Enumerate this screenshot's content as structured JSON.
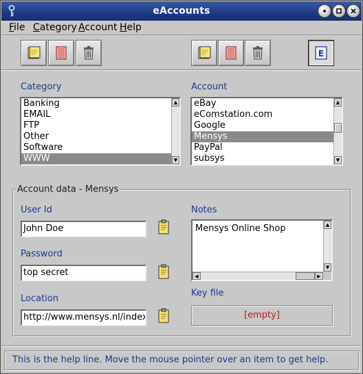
{
  "window": {
    "title": "eAccounts"
  },
  "menu": [
    {
      "label": "File",
      "mnemonic": "F",
      "rest": "ile"
    },
    {
      "label": "Category",
      "mnemonic": "C",
      "rest": "ategory"
    },
    {
      "label": "Account",
      "mnemonic": "A",
      "rest": "ccount"
    },
    {
      "label": "Help",
      "mnemonic": "H",
      "rest": "elp"
    }
  ],
  "toolbar": {
    "category_tools": [
      "new-note-icon",
      "edit-note-icon",
      "trash-icon"
    ],
    "account_tools": [
      "new-note-icon",
      "edit-note-icon",
      "trash-icon"
    ],
    "e_button": "E"
  },
  "category": {
    "label": "Category",
    "items": [
      "Banking",
      "EMAIL",
      "FTP",
      "Other",
      "Software",
      "WWW"
    ],
    "selected": "WWW"
  },
  "account": {
    "label": "Account",
    "items": [
      "eBay",
      "eComstation.com",
      "Google",
      "Mensys",
      "PayPal",
      "subsys"
    ],
    "selected": "Mensys"
  },
  "account_data": {
    "title": "Account data - Mensys",
    "user_id_label": "User Id",
    "user_id": "John Doe",
    "password_label": "Password",
    "password": "top secret",
    "location_label": "Location",
    "location": "http://www.mensys.nl/indexn",
    "notes_label": "Notes",
    "notes": "Mensys Online Shop",
    "key_file_label": "Key file",
    "key_file": "[empty]"
  },
  "help_line": "This is the help line. Move the mouse pointer over an item to get help.",
  "colors": {
    "title_bar": "#1d3a86",
    "label_blue": "#1b3b8c",
    "key_file_red": "#b02020",
    "selection": "#8a8a8a"
  }
}
